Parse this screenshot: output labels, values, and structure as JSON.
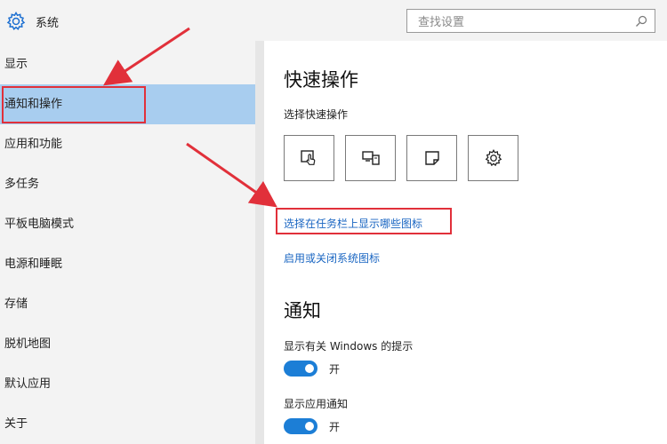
{
  "header": {
    "title": "系统",
    "search_placeholder": "查找设置"
  },
  "sidebar": {
    "items": [
      {
        "label": "显示"
      },
      {
        "label": "通知和操作"
      },
      {
        "label": "应用和功能"
      },
      {
        "label": "多任务"
      },
      {
        "label": "平板电脑模式"
      },
      {
        "label": "电源和睡眠"
      },
      {
        "label": "存储"
      },
      {
        "label": "脱机地图"
      },
      {
        "label": "默认应用"
      },
      {
        "label": "关于"
      }
    ]
  },
  "main": {
    "quick_actions_title": "快速操作",
    "quick_actions_subtitle": "选择快速操作",
    "quick_action_icons": [
      "tablet-mode-icon",
      "project-icon",
      "note-icon",
      "settings-icon"
    ],
    "link_taskbar_icons": "选择在任务栏上显示哪些图标",
    "link_system_icons": "启用或关闭系统图标",
    "notifications_title": "通知",
    "option_windows_tips": "显示有关 Windows 的提示",
    "option_app_notifications": "显示应用通知",
    "toggle_on_label": "开",
    "toggle_on_label_2": "开"
  },
  "colors": {
    "accent": "#1c7ed6",
    "selected_bg": "#a8cdef",
    "annotation_red": "#e1303a",
    "link": "#1a66c2"
  }
}
